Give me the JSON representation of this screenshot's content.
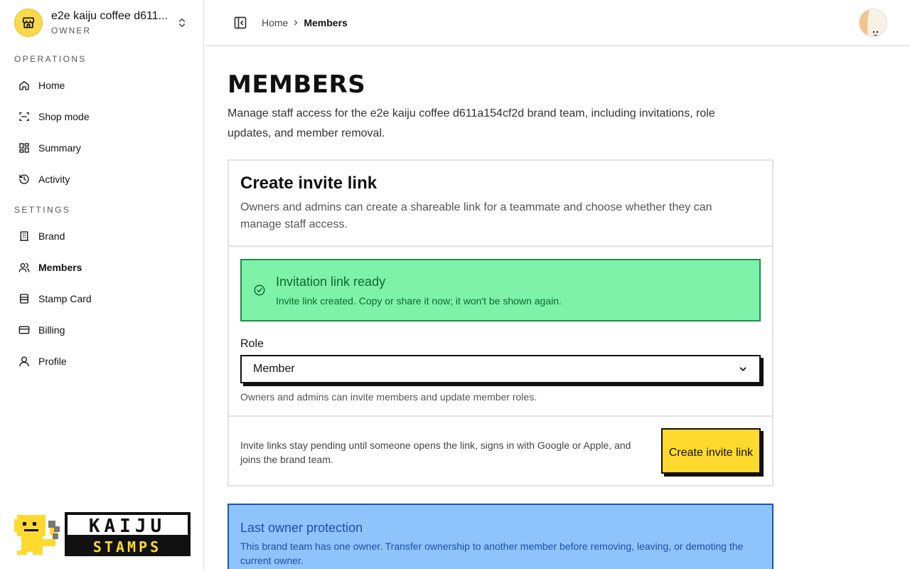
{
  "sidebar": {
    "team": {
      "name": "e2e kaiju coffee d611...",
      "role": "OWNER"
    },
    "sections": [
      {
        "label": "OPERATIONS"
      },
      {
        "label": "SETTINGS"
      }
    ],
    "items": [
      {
        "label": "Home",
        "icon": "home-icon"
      },
      {
        "label": "Shop mode",
        "icon": "scan-icon"
      },
      {
        "label": "Summary",
        "icon": "dashboard-icon"
      },
      {
        "label": "Activity",
        "icon": "history-icon"
      },
      {
        "label": "Brand",
        "icon": "building-icon"
      },
      {
        "label": "Members",
        "icon": "users-icon",
        "active": true
      },
      {
        "label": "Stamp Card",
        "icon": "card-stack-icon"
      },
      {
        "label": "Billing",
        "icon": "credit-card-icon"
      },
      {
        "label": "Profile",
        "icon": "user-icon"
      }
    ],
    "logo": {
      "line1": "KAIJU",
      "line2": "STAMPS"
    }
  },
  "topbar": {
    "breadcrumb": {
      "home": "Home",
      "current": "Members"
    }
  },
  "main": {
    "title": "MEMBERS",
    "description": "Manage staff access for the e2e kaiju coffee d611a154cf2d brand team, including invitations, role updates, and member removal.",
    "invite_card": {
      "title": "Create invite link",
      "subtitle": "Owners and admins can create a shareable link for a teammate and choose whether they can manage staff access.",
      "success_alert": {
        "title": "Invitation link ready",
        "body": "Invite link created. Copy or share it now; it won't be shown again."
      },
      "role_label": "Role",
      "role_value": "Member",
      "role_hint": "Owners and admins can invite members and update member roles.",
      "footer_text": "Invite links stay pending until someone opens the link, signs in with Google or Apple, and joins the brand team.",
      "create_button": "Create invite link"
    },
    "info_alert": {
      "title": "Last owner protection",
      "body": "This brand team has one owner. Transfer ownership to another member before removing, leaving, or demoting the current owner."
    }
  },
  "colors": {
    "accent_yellow": "#ffd92e",
    "success_bg": "#7ef2a8",
    "success_text": "#0e6a31",
    "info_bg": "#8ec4fb",
    "info_text": "#1d4fa8"
  }
}
